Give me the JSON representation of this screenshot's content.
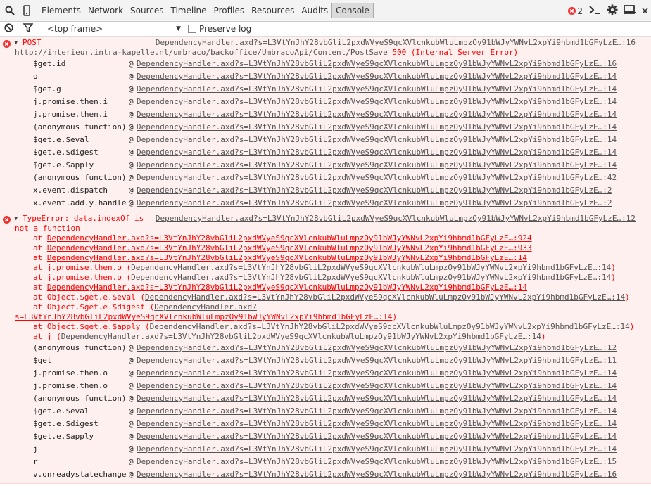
{
  "toolbar": {
    "tabs": [
      "Elements",
      "Network",
      "Sources",
      "Timeline",
      "Profiles",
      "Resources",
      "Audits",
      "Console"
    ],
    "active_tab": "Console",
    "error_count": "2"
  },
  "subbar": {
    "frame": "<top frame>",
    "preserve_log": "Preserve log"
  },
  "messages": [
    {
      "header": "POST",
      "source": "DependencyHandler.axd?s=L3VtYnJhY28vbGliL2pxdWVyeS9qcXVlcnkubWluLmpzOy91bWJyYWNvL2xpYi9hbmd1bGFyLzE…:16",
      "url": "http://interieur.intra-kapelle.nl/umbraco/backoffice/UmbracoApi/Content/PostSave",
      "status": "500 (Internal Server Error)",
      "stack": [
        {
          "fn": "$get.id",
          "loc": "DependencyHandler.axd?s=L3VtYnJhY28vbGliL2pxdWVyeS9qcXVlcnkubWluLmpzOy91bWJyYWNvL2xpYi9hbmd1bGFyLzE…:16"
        },
        {
          "fn": "o",
          "loc": "DependencyHandler.axd?s=L3VtYnJhY28vbGliL2pxdWVyeS9qcXVlcnkubWluLmpzOy91bWJyYWNvL2xpYi9hbmd1bGFyLzE…:14"
        },
        {
          "fn": "$get.g",
          "loc": "DependencyHandler.axd?s=L3VtYnJhY28vbGliL2pxdWVyeS9qcXVlcnkubWluLmpzOy91bWJyYWNvL2xpYi9hbmd1bGFyLzE…:14"
        },
        {
          "fn": "j.promise.then.i",
          "loc": "DependencyHandler.axd?s=L3VtYnJhY28vbGliL2pxdWVyeS9qcXVlcnkubWluLmpzOy91bWJyYWNvL2xpYi9hbmd1bGFyLzE…:14"
        },
        {
          "fn": "j.promise.then.i",
          "loc": "DependencyHandler.axd?s=L3VtYnJhY28vbGliL2pxdWVyeS9qcXVlcnkubWluLmpzOy91bWJyYWNvL2xpYi9hbmd1bGFyLzE…:14"
        },
        {
          "fn": "(anonymous function)",
          "loc": "DependencyHandler.axd?s=L3VtYnJhY28vbGliL2pxdWVyeS9qcXVlcnkubWluLmpzOy91bWJyYWNvL2xpYi9hbmd1bGFyLzE…:14"
        },
        {
          "fn": "$get.e.$eval",
          "loc": "DependencyHandler.axd?s=L3VtYnJhY28vbGliL2pxdWVyeS9qcXVlcnkubWluLmpzOy91bWJyYWNvL2xpYi9hbmd1bGFyLzE…:14"
        },
        {
          "fn": "$get.e.$digest",
          "loc": "DependencyHandler.axd?s=L3VtYnJhY28vbGliL2pxdWVyeS9qcXVlcnkubWluLmpzOy91bWJyYWNvL2xpYi9hbmd1bGFyLzE…:14"
        },
        {
          "fn": "$get.e.$apply",
          "loc": "DependencyHandler.axd?s=L3VtYnJhY28vbGliL2pxdWVyeS9qcXVlcnkubWluLmpzOy91bWJyYWNvL2xpYi9hbmd1bGFyLzE…:14"
        },
        {
          "fn": "(anonymous function)",
          "loc": "DependencyHandler.axd?s=L3VtYnJhY28vbGliL2pxdWVyeS9qcXVlcnkubWluLmpzOy91bWJyYWNvL2xpYi9hbmd1bGFyLzE…:42"
        },
        {
          "fn": "x.event.dispatch",
          "loc": "DependencyHandler.axd?s=L3VtYnJhY28vbGliL2pxdWVyeS9qcXVlcnkubWluLmpzOy91bWJyYWNvL2xpYi9hbmd1bGFyLzE…:2"
        },
        {
          "fn": "x.event.add.y.handle",
          "loc": "DependencyHandler.axd?s=L3VtYnJhY28vbGliL2pxdWVyeS9qcXVlcnkubWluLmpzOy91bWJyYWNvL2xpYi9hbmd1bGFyLzE…:2"
        }
      ]
    },
    {
      "header1": "TypeError: data.indexOf is",
      "header2": "not a function",
      "source": "DependencyHandler.axd?s=L3VtYnJhY28vbGliL2pxdWVyeS9qcXVlcnkubWluLmpzOy91bWJyYWNvL2xpYi9hbmd1bGFyLzE…:12",
      "trace": [
        {
          "pre": "at ",
          "link": "DependencyHandler.axd?s=L3VtYnJhY28vbGliL2pxdWVyeS9qcXVlcnkubWluLmpzOy91bWJyYWNvL2xpYi9hbmd1bGFyLzE…:924",
          "post": ""
        },
        {
          "pre": "at ",
          "link": "DependencyHandler.axd?s=L3VtYnJhY28vbGliL2pxdWVyeS9qcXVlcnkubWluLmpzOy91bWJyYWNvL2xpYi9hbmd1bGFyLzE…:933",
          "post": ""
        },
        {
          "pre": "at ",
          "link": "DependencyHandler.axd?s=L3VtYnJhY28vbGliL2pxdWVyeS9qcXVlcnkubWluLmpzOy91bWJyYWNvL2xpYi9hbmd1bGFyLzE…:14",
          "post": ""
        },
        {
          "pre": "at j.promise.then.o (",
          "link": "DependencyHandler.axd?s=L3VtYnJhY28vbGliL2pxdWVyeS9qcXVlcnkubWluLmpzOy91bWJyYWNvL2xpYi9hbmd1bGFyLzE…:14",
          "post": ")"
        },
        {
          "pre": "at j.promise.then.o (",
          "link": "DependencyHandler.axd?s=L3VtYnJhY28vbGliL2pxdWVyeS9qcXVlcnkubWluLmpzOy91bWJyYWNvL2xpYi9hbmd1bGFyLzE…:14",
          "post": ")"
        },
        {
          "pre": "at ",
          "link": "DependencyHandler.axd?s=L3VtYnJhY28vbGliL2pxdWVyeS9qcXVlcnkubWluLmpzOy91bWJyYWNvL2xpYi9hbmd1bGFyLzE…:14",
          "post": ""
        },
        {
          "pre": "at Object.$get.e.$eval (",
          "link": "DependencyHandler.axd?s=L3VtYnJhY28vbGliL2pxdWVyeS9qcXVlcnkubWluLmpzOy91bWJyYWNvL2xpYi9hbmd1bGFyLzE…:14",
          "post": ")"
        },
        {
          "pre": "at Object.$get.e.$digest (",
          "link": "DependencyHandler.axd?",
          "post": ""
        }
      ],
      "trace_wrap": {
        "link": "s=L3VtYnJhY28vbGliL2pxdWVyeS9qcXVlcnkubWluLmpzOy91bWJyYWNvL2xpYi9hbmd1bGFyLzE…:14",
        "post": ")"
      },
      "trace_tail": [
        {
          "pre": "at Object.$get.e.$apply (",
          "link": "DependencyHandler.axd?s=L3VtYnJhY28vbGliL2pxdWVyeS9qcXVlcnkubWluLmpzOy91bWJyYWNvL2xpYi9hbmd1bGFyLzE…:14",
          "post": ")"
        },
        {
          "pre": "at j (",
          "link": "DependencyHandler.axd?s=L3VtYnJhY28vbGliL2pxdWVyeS9qcXVlcnkubWluLmpzOy91bWJyYWNvL2xpYi9hbmd1bGFyLzE…:14",
          "post": ")"
        }
      ],
      "stack": [
        {
          "fn": "(anonymous function)",
          "loc": "DependencyHandler.axd?s=L3VtYnJhY28vbGliL2pxdWVyeS9qcXVlcnkubWluLmpzOy91bWJyYWNvL2xpYi9hbmd1bGFyLzE…:12"
        },
        {
          "fn": "$get",
          "loc": "DependencyHandler.axd?s=L3VtYnJhY28vbGliL2pxdWVyeS9qcXVlcnkubWluLmpzOy91bWJyYWNvL2xpYi9hbmd1bGFyLzE…:11"
        },
        {
          "fn": "j.promise.then.o",
          "loc": "DependencyHandler.axd?s=L3VtYnJhY28vbGliL2pxdWVyeS9qcXVlcnkubWluLmpzOy91bWJyYWNvL2xpYi9hbmd1bGFyLzE…:14"
        },
        {
          "fn": "j.promise.then.o",
          "loc": "DependencyHandler.axd?s=L3VtYnJhY28vbGliL2pxdWVyeS9qcXVlcnkubWluLmpzOy91bWJyYWNvL2xpYi9hbmd1bGFyLzE…:14"
        },
        {
          "fn": "(anonymous function)",
          "loc": "DependencyHandler.axd?s=L3VtYnJhY28vbGliL2pxdWVyeS9qcXVlcnkubWluLmpzOy91bWJyYWNvL2xpYi9hbmd1bGFyLzE…:14"
        },
        {
          "fn": "$get.e.$eval",
          "loc": "DependencyHandler.axd?s=L3VtYnJhY28vbGliL2pxdWVyeS9qcXVlcnkubWluLmpzOy91bWJyYWNvL2xpYi9hbmd1bGFyLzE…:14"
        },
        {
          "fn": "$get.e.$digest",
          "loc": "DependencyHandler.axd?s=L3VtYnJhY28vbGliL2pxdWVyeS9qcXVlcnkubWluLmpzOy91bWJyYWNvL2xpYi9hbmd1bGFyLzE…:14"
        },
        {
          "fn": "$get.e.$apply",
          "loc": "DependencyHandler.axd?s=L3VtYnJhY28vbGliL2pxdWVyeS9qcXVlcnkubWluLmpzOy91bWJyYWNvL2xpYi9hbmd1bGFyLzE…:14"
        },
        {
          "fn": "j",
          "loc": "DependencyHandler.axd?s=L3VtYnJhY28vbGliL2pxdWVyeS9qcXVlcnkubWluLmpzOy91bWJyYWNvL2xpYi9hbmd1bGFyLzE…:14"
        },
        {
          "fn": "r",
          "loc": "DependencyHandler.axd?s=L3VtYnJhY28vbGliL2pxdWVyeS9qcXVlcnkubWluLmpzOy91bWJyYWNvL2xpYi9hbmd1bGFyLzE…:15"
        },
        {
          "fn": "v.onreadystatechange",
          "loc": "DependencyHandler.axd?s=L3VtYnJhY28vbGliL2pxdWVyeS9qcXVlcnkubWluLmpzOy91bWJyYWNvL2xpYi9hbmd1bGFyLzE…:16"
        }
      ]
    }
  ],
  "colors": {
    "error": "#ff0000",
    "error_bg": "#fff0f0",
    "toolbar_bg": "#f3f3f3"
  }
}
